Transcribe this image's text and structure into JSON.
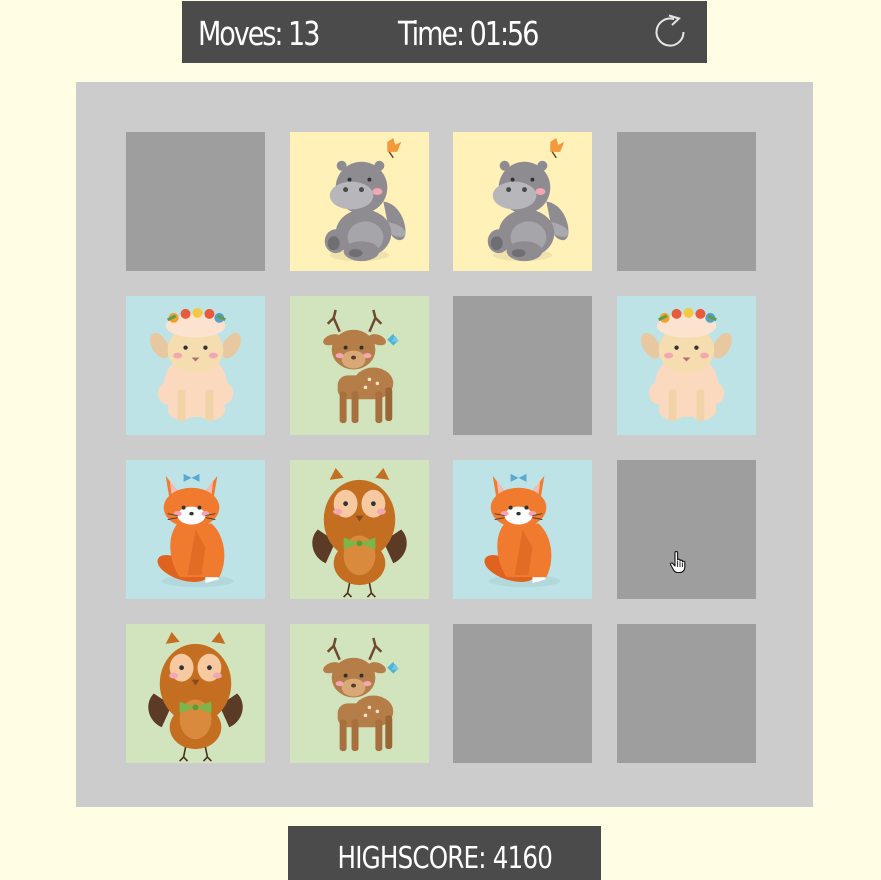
{
  "hud": {
    "moves_label": "Moves: 13",
    "time_label": "Time: 01:56",
    "restart_icon": "restart-icon"
  },
  "board": {
    "background": "#cccccc",
    "card_back_color": "#9e9e9e",
    "rows": [
      [
        {
          "state": "face-down"
        },
        {
          "state": "face-up",
          "animal": "hippo",
          "bg": "#fff1b8"
        },
        {
          "state": "face-up",
          "animal": "hippo",
          "bg": "#fff1b8"
        },
        {
          "state": "face-down"
        }
      ],
      [
        {
          "state": "face-up",
          "animal": "sheep",
          "bg": "#bde3e6"
        },
        {
          "state": "face-up",
          "animal": "deer",
          "bg": "#d2e4bd"
        },
        {
          "state": "face-down"
        },
        {
          "state": "face-up",
          "animal": "sheep",
          "bg": "#bde3e6"
        }
      ],
      [
        {
          "state": "face-up",
          "animal": "fox",
          "bg": "#bde3e6"
        },
        {
          "state": "face-up",
          "animal": "owl",
          "bg": "#d2e4bd"
        },
        {
          "state": "face-up",
          "animal": "fox",
          "bg": "#bde3e6"
        },
        {
          "state": "face-down"
        }
      ],
      [
        {
          "state": "face-up",
          "animal": "owl",
          "bg": "#d2e4bd"
        },
        {
          "state": "face-up",
          "animal": "deer",
          "bg": "#d2e4bd"
        },
        {
          "state": "face-down"
        },
        {
          "state": "face-down"
        }
      ]
    ]
  },
  "footer": {
    "highscore_label": "HIGHSCORE: 4160"
  },
  "colors": {
    "page_background": "#fffde3",
    "bar_background": "#4b4b4b",
    "bar_text": "#ffffff"
  }
}
